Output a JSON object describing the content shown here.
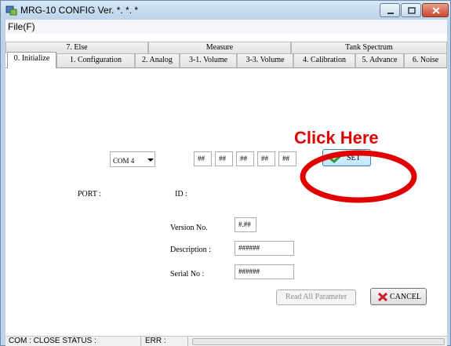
{
  "window": {
    "title": "MRG-10 CONFIG Ver. *. *. *",
    "menu": {
      "file_label": "File(F)"
    }
  },
  "tabs_row1": [
    {
      "label": "7. Else"
    },
    {
      "label": "Measure"
    },
    {
      "label": "Tank Spectrum"
    }
  ],
  "tabs_row2": [
    {
      "label": "0. Initialize",
      "active": true
    },
    {
      "label": "1. Configuration"
    },
    {
      "label": "2. Analog"
    },
    {
      "label": "3-1. Volume"
    },
    {
      "label": "3-3. Volume"
    },
    {
      "label": "4. Calibration"
    },
    {
      "label": "5. Advance"
    },
    {
      "label": "6. Noise"
    }
  ],
  "initialize": {
    "port_label": "PORT :",
    "port_value": "COM 4",
    "id_label": "ID :",
    "id_fields": [
      "##",
      "##",
      "##",
      "##",
      "##"
    ],
    "set_label": "SET",
    "version_label": "Version No.",
    "version_value": "#.##",
    "description_label": "Description :",
    "description_value": "######",
    "serial_label": "Serial No :",
    "serial_value": "######",
    "read_all_label": "Read All Parameter",
    "cancel_label": "CANCEL"
  },
  "annotation": {
    "text": "Click Here",
    "color": "#e00000"
  },
  "statusbar": {
    "com_status": "COM : CLOSE STATUS :",
    "err_label": "ERR :",
    "progress": 0
  },
  "colors": {
    "frame": "#bcd3ea",
    "set_check": "#2f9b2f",
    "cancel_x": "#c8202a"
  }
}
